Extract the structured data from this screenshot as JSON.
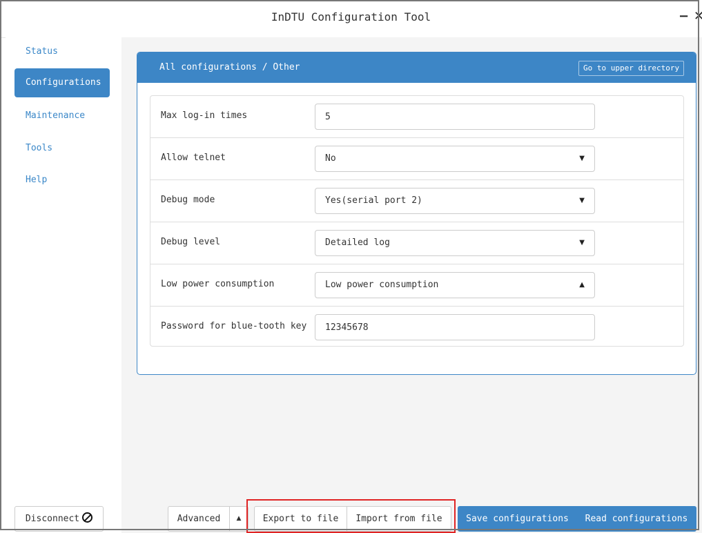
{
  "window": {
    "title": "InDTU Configuration Tool",
    "minimize_glyph": "−",
    "close_glyph": "✕"
  },
  "sidebar": {
    "items": [
      {
        "label": "Status",
        "active": false
      },
      {
        "label": "Configurations",
        "active": true
      },
      {
        "label": "Maintenance",
        "active": false
      },
      {
        "label": "Tools",
        "active": false
      },
      {
        "label": "Help",
        "active": false
      }
    ]
  },
  "panel": {
    "breadcrumb": "All configurations /  Other",
    "upper_button": "Go to upper directory"
  },
  "form": {
    "rows": [
      {
        "label": "Max log-in times",
        "type": "input",
        "value": "5"
      },
      {
        "label": "Allow telnet",
        "type": "select",
        "value": "No",
        "caret": "▼"
      },
      {
        "label": "Debug mode",
        "type": "select",
        "value": "Yes(serial port 2)",
        "caret": "▼"
      },
      {
        "label": "Debug level",
        "type": "select",
        "value": "Detailed log",
        "caret": "▼"
      },
      {
        "label": "Low power consumption",
        "type": "select",
        "value": "Low power consumption",
        "caret": "▲"
      },
      {
        "label": "Password for blue-tooth key",
        "type": "input",
        "value": "12345678"
      }
    ]
  },
  "footer": {
    "disconnect": "Disconnect",
    "advanced": "Advanced",
    "advanced_caret": "▲",
    "export": "Export to file",
    "import": "Import from file",
    "save": "Save configurations",
    "read": "Read configurations"
  },
  "colors": {
    "accent": "#3d86c6",
    "highlight": "#e02424"
  }
}
